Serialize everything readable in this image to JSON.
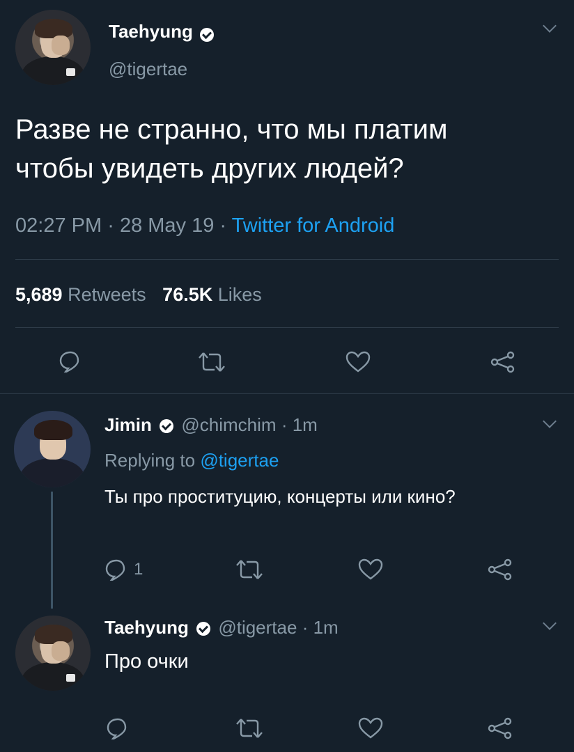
{
  "main_tweet": {
    "author_name": "Taehyung",
    "author_handle": "@tigertae",
    "text_line1": "Разве не странно, что мы платим",
    "text_line2": "чтобы увидеть других людей?",
    "time": "02:27 PM",
    "date": "28 May 19",
    "sep1": "·",
    "sep2": "·",
    "source": "Twitter for Android",
    "retweets_count": "5,689",
    "retweets_label": "Retweets",
    "likes_count": "76.5K",
    "likes_label": "Likes"
  },
  "reply1": {
    "author_name": "Jimin",
    "author_handle": "@chimchim",
    "sep": "·",
    "time": "1m",
    "replying_prefix": "Replying to",
    "replying_handle": "@tigertae",
    "text": "Ты про проституцию, концерты или кино?",
    "reply_count": "1"
  },
  "reply2": {
    "author_name": "Taehyung",
    "author_handle": "@tigertae",
    "sep": "·",
    "time": "1m",
    "text": "Про очки"
  },
  "colors": {
    "background": "#15202b",
    "secondary_text": "#8899a6",
    "link": "#1da1f2",
    "divider": "#2f3d4a"
  },
  "icons": {
    "reply": "reply-icon",
    "retweet": "retweet-icon",
    "like": "heart-icon",
    "share": "share-icon",
    "verified": "verified-badge-icon",
    "menu": "chevron-down-icon"
  }
}
